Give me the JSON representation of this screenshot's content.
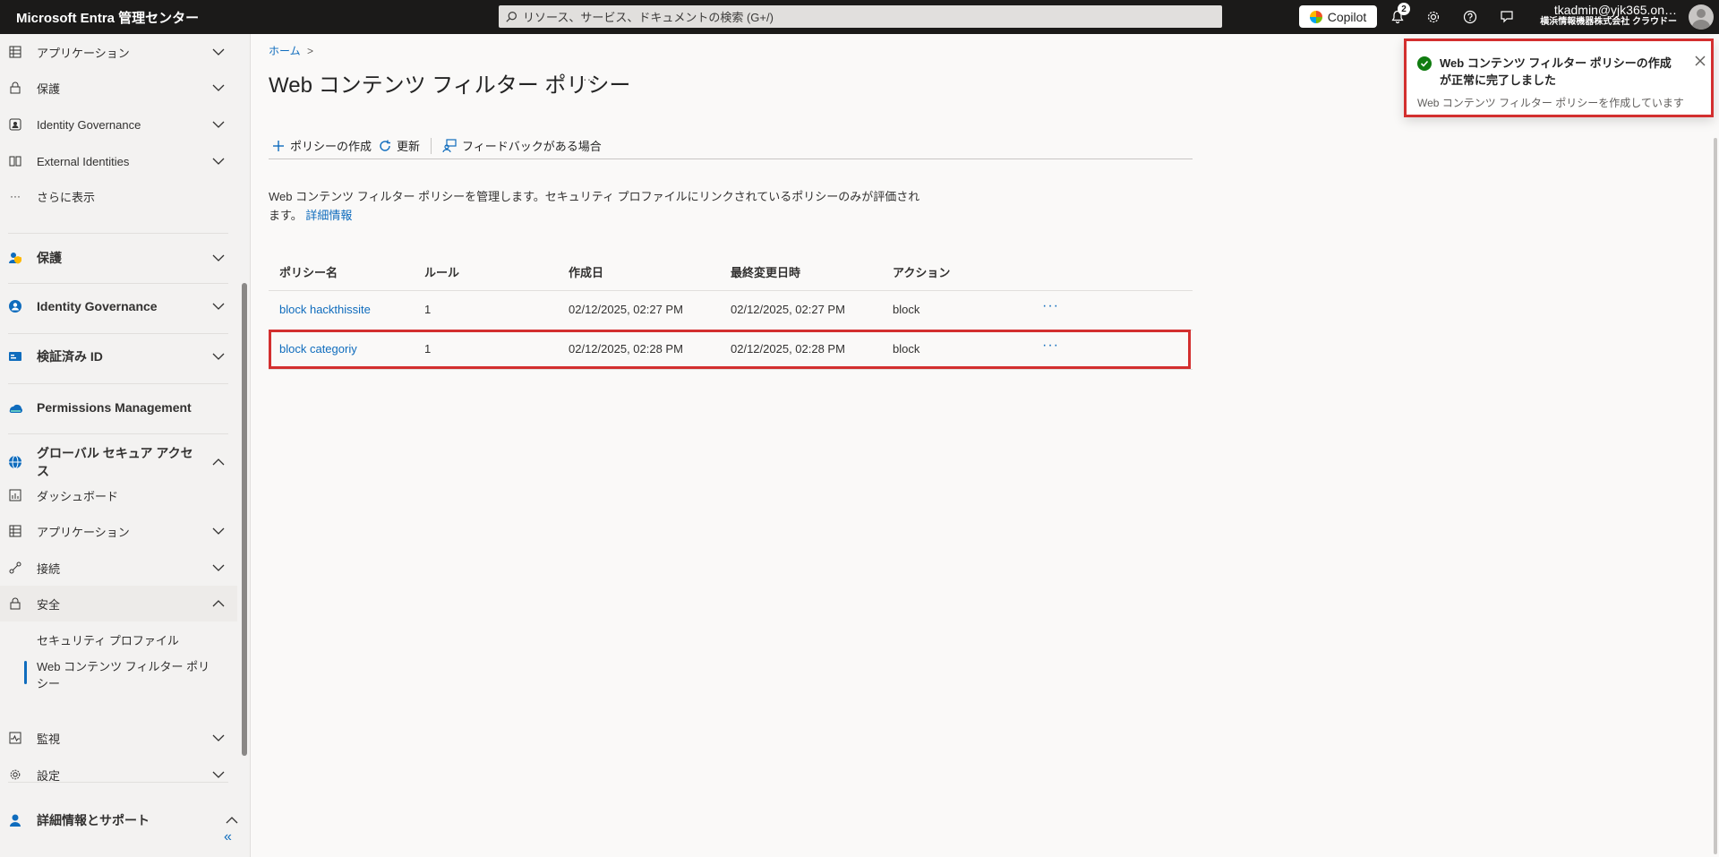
{
  "topbar": {
    "brand": "Microsoft Entra 管理センター",
    "search_placeholder": "リソース、サービス、ドキュメントの検索 (G+/)",
    "copilot_label": "Copilot",
    "notification_count": "2",
    "account_email": "tkadmin@yjk365.on…",
    "account_org": "横浜情報機器株式会社 クラウドー"
  },
  "sidebar": {
    "items": [
      {
        "label": "アプリケーション",
        "icon": "grid-icon"
      },
      {
        "label": "保護",
        "icon": "lock-icon"
      },
      {
        "label": "Identity Governance",
        "icon": "id-governance-icon"
      },
      {
        "label": "External Identities",
        "icon": "external-identities-icon"
      },
      {
        "label": "さらに表示",
        "icon": "more-icon"
      }
    ],
    "sections": [
      {
        "label": "保護",
        "icon": "protect-icon"
      },
      {
        "label": "Identity Governance",
        "icon": "identity-governance-icon"
      },
      {
        "label": "検証済み ID",
        "icon": "verified-id-icon"
      },
      {
        "label": "Permissions Management",
        "icon": "permissions-icon"
      },
      {
        "label": "グローバル セキュア アクセス",
        "icon": "globe-icon"
      }
    ],
    "gsa_items": [
      {
        "label": "ダッシュボード",
        "icon": "dashboard-icon"
      },
      {
        "label": "アプリケーション",
        "icon": "grid-icon"
      },
      {
        "label": "接続",
        "icon": "connect-icon"
      },
      {
        "label": "安全",
        "icon": "lock-icon"
      }
    ],
    "security_sub": [
      "セキュリティ プロファイル",
      "Web コンテンツ フィルター ポリシー"
    ],
    "bottom_items": [
      {
        "label": "監視",
        "icon": "monitor-icon"
      },
      {
        "label": "設定",
        "icon": "settings-icon"
      }
    ],
    "help_section": "詳細情報とサポート",
    "collapse_glyph": "«"
  },
  "main": {
    "breadcrumb": "ホーム",
    "breadcrumb_sep": ">",
    "title": "Web コンテンツ フィルター ポリシー",
    "title_more": "···",
    "commands": {
      "create": "ポリシーの作成",
      "refresh": "更新",
      "feedback": "フィードバックがある場合"
    },
    "description": "Web コンテンツ フィルター ポリシーを管理します。セキュリティ プロファイルにリンクされているポリシーのみが評価されます。",
    "learn_more": "詳細情報",
    "table": {
      "headers": [
        "ポリシー名",
        "ルール",
        "作成日",
        "最終変更日時",
        "アクション"
      ],
      "rows": [
        {
          "name": "block hackthissite",
          "rules": "1",
          "created": "02/12/2025, 02:27 PM",
          "modified": "02/12/2025, 02:27 PM",
          "action": "block"
        },
        {
          "name": "block categoriy",
          "rules": "1",
          "created": "02/12/2025, 02:28 PM",
          "modified": "02/12/2025, 02:28 PM",
          "action": "block"
        }
      ],
      "row_more": "···"
    }
  },
  "toast": {
    "title": "Web コンテンツ フィルター ポリシーの作成が正常に完了しました",
    "subtitle": "Web コンテンツ フィルター ポリシーを作成しています"
  },
  "colors": {
    "accent": "#0f6cbd",
    "success": "#107c10",
    "highlight": "#d32f2f",
    "topbar": "#1b1a19"
  }
}
